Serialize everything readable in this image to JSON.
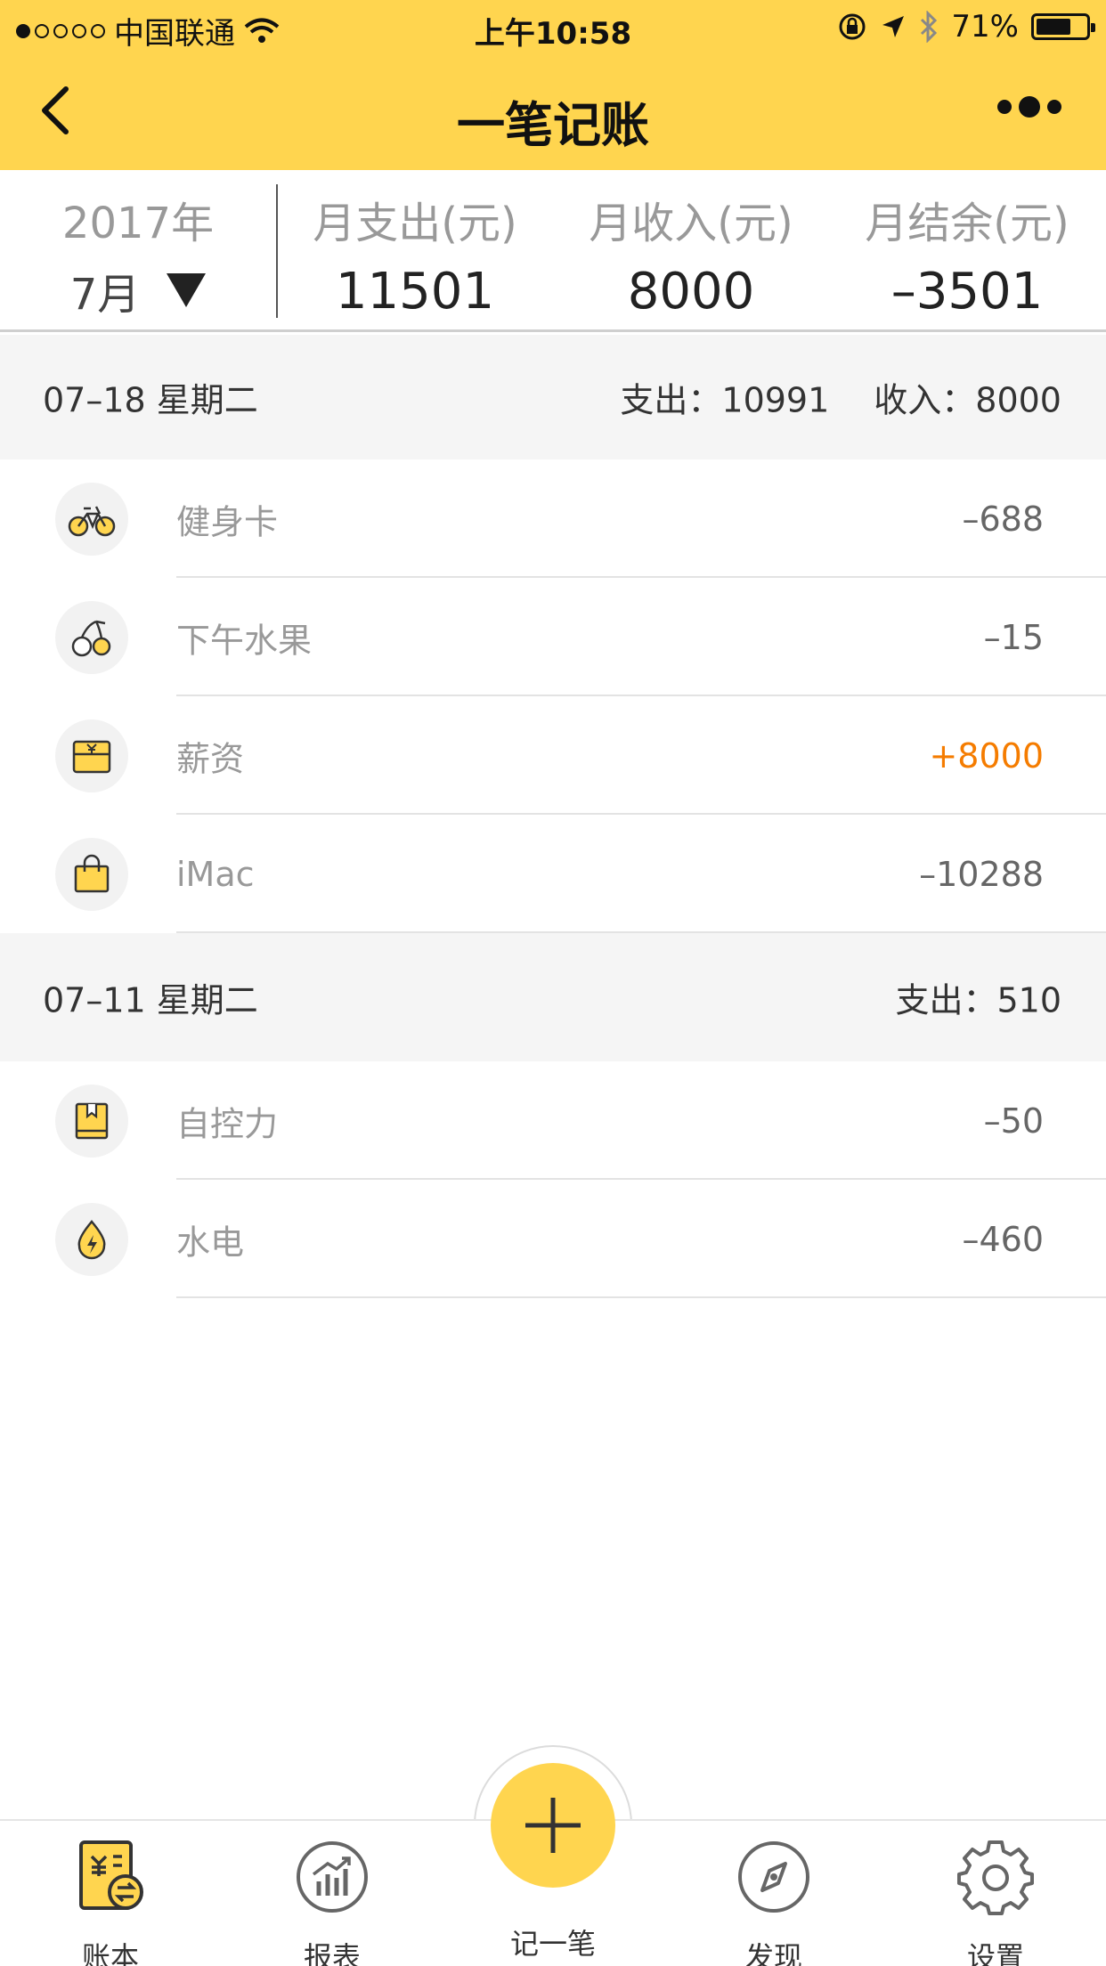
{
  "status_bar": {
    "carrier": "中国联通",
    "time": "上午10:58",
    "battery": "71%",
    "battery_level": 0.71
  },
  "nav": {
    "title": "一笔记账"
  },
  "summary": {
    "year": "2017年",
    "month": "7月",
    "expense_label": "月支出(元)",
    "expense_value": "11501",
    "income_label": "月收入(元)",
    "income_value": "8000",
    "balance_label": "月结余(元)",
    "balance_value": "–3501"
  },
  "days": [
    {
      "date": "07–18 星期二",
      "expense": "支出：10991",
      "income": "收入：8000",
      "items": [
        {
          "icon": "bicycle-icon",
          "name": "健身卡",
          "amount": "–688",
          "type": "expense"
        },
        {
          "icon": "cherry-icon",
          "name": "下午水果",
          "amount": "–15",
          "type": "expense"
        },
        {
          "icon": "salary-box-icon",
          "name": "薪资",
          "amount": "+8000",
          "type": "income"
        },
        {
          "icon": "shopping-bag-icon",
          "name": "iMac",
          "amount": "–10288",
          "type": "expense"
        }
      ]
    },
    {
      "date": "07–11 星期二",
      "expense": "支出：510",
      "income": "",
      "items": [
        {
          "icon": "book-icon",
          "name": "自控力",
          "amount": "–50",
          "type": "expense"
        },
        {
          "icon": "water-electric-icon",
          "name": "水电",
          "amount": "–460",
          "type": "expense"
        }
      ]
    }
  ],
  "tabbar": {
    "ledger": "账本",
    "report": "报表",
    "add": "记一笔",
    "discover": "发现",
    "settings": "设置"
  },
  "colors": {
    "accent": "#FFD54F",
    "income": "#F57C00"
  }
}
